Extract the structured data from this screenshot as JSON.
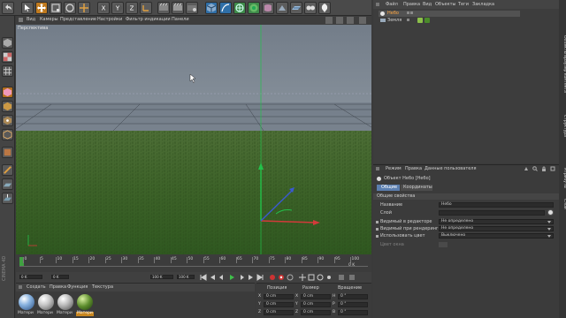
{
  "viewport": {
    "menu": [
      "Вид",
      "Камеры",
      "Представление",
      "Настройки",
      "Фильтр индикации",
      "Панели"
    ],
    "label": "Перспектива"
  },
  "timeline": {
    "ticks": [
      "0",
      "5",
      "10",
      "15",
      "20",
      "25",
      "30",
      "35",
      "40",
      "45",
      "50",
      "55",
      "60",
      "65",
      "70",
      "75",
      "80",
      "85",
      "90",
      "95",
      "100"
    ],
    "end_label": "0 K",
    "start_field": "0 K",
    "current_field": "0 K",
    "end_field": "100 K",
    "max_field": "100 K"
  },
  "materials": {
    "menu": [
      "Создать",
      "Правка",
      "Функция",
      "Текстура"
    ],
    "items": [
      "Матери",
      "Матери",
      "Матери",
      "Матери"
    ]
  },
  "coordinates": {
    "headers": [
      "Позиция",
      "Размер",
      "Вращение"
    ],
    "rows": [
      {
        "axis": "X",
        "pos": "0 cm",
        "size": "0 cm",
        "rot_axis": "H",
        "rot": "0 °"
      },
      {
        "axis": "Y",
        "pos": "0 cm",
        "size": "0 cm",
        "rot_axis": "P",
        "rot": "0 °"
      },
      {
        "axis": "Z",
        "pos": "0 cm",
        "size": "0 cm",
        "rot_axis": "B",
        "rot": "0 °"
      }
    ]
  },
  "object_manager": {
    "menu": [
      "Файл",
      "Правка",
      "Вид",
      "Объекты",
      "Теги",
      "Закладка"
    ],
    "objects": [
      "Небо",
      "Земля"
    ]
  },
  "attributes": {
    "menu": [
      "Режим",
      "Правка",
      "Данные пользователя"
    ],
    "object_title": "Объект Небо [Небо]",
    "tabs": [
      "Общие",
      "Координаты"
    ],
    "section": "Общие свойства",
    "name_label": "Название",
    "name_value": "Небо",
    "layer_label": "Слой",
    "props": [
      {
        "label": "Видимый в редакторе",
        "value": "Не определено"
      },
      {
        "label": "Видимый при рендеринге",
        "value": "Не определено"
      },
      {
        "label": "Использовать цвет",
        "value": "Выключено"
      }
    ],
    "color_label": "Цвет окна"
  },
  "side_tabs": {
    "right_top": "Объекты",
    "right_mid": "Браузер контента",
    "right_low": "Структура",
    "right_bottom": "Атрибуты",
    "right_last": "Слои",
    "left_vertical": "CINEMA 4D"
  },
  "colors": {
    "accent": "#d08a2a",
    "sky": "#7d8896",
    "grass": "#3e6a2a",
    "axis_y": "#22c24a",
    "axis_x": "#d23a3a",
    "axis_z": "#3a5ad0"
  }
}
